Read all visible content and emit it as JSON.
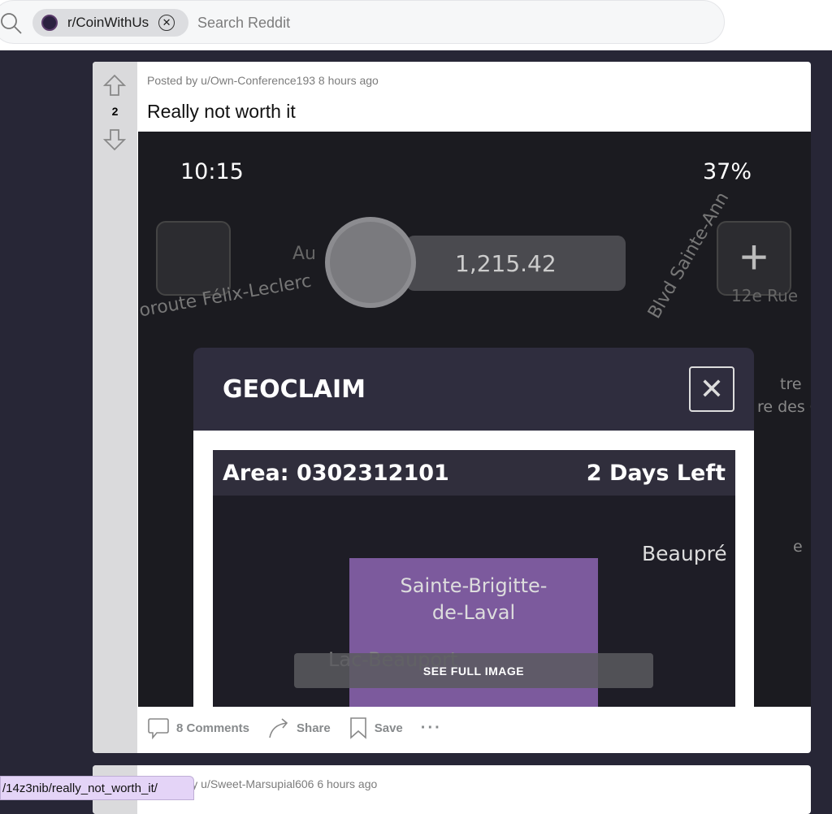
{
  "search": {
    "community_chip": "r/CoinWithUs",
    "placeholder": "Search Reddit"
  },
  "post": {
    "posted_by": "Posted by u/Own-Conference193 8 hours ago",
    "title": "Really not worth it",
    "votes": "2",
    "image": {
      "time": "10:15",
      "battery": "37%",
      "balance": "1,215.42",
      "map_labels": [
        "Au",
        "oroute Félix-Leclerc",
        "Blvd Sainte-Ann",
        "12e Rue",
        "tre",
        "re des C",
        "e"
      ],
      "modal_title": "GEOCLAIM",
      "area": "Area: 0302312101",
      "days_left": "2 Days Left",
      "place1": "Beaupré",
      "place2": "Sainte-Brigitte-\nde-Laval",
      "place3": "Lac-Beauport"
    },
    "see_full": "SEE FULL IMAGE",
    "actions": {
      "comments": "8 Comments",
      "share": "Share",
      "save": "Save"
    }
  },
  "next_post": {
    "posted_by": "Posted by u/Sweet-Marsupial606 6 hours ago"
  },
  "status_url": "/14z3nib/really_not_worth_it/"
}
